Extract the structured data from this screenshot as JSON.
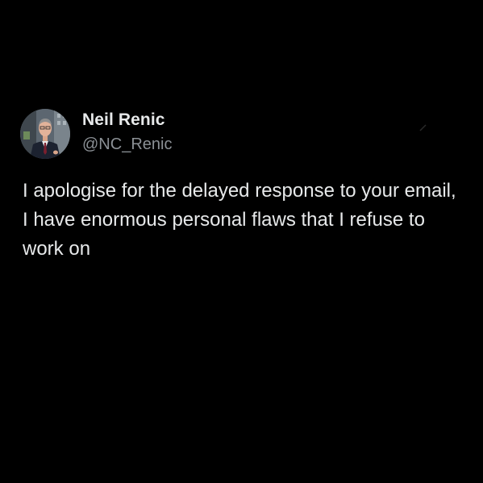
{
  "author": {
    "name": "Neil Renic",
    "handle": "@NC_Renic"
  },
  "tweet": {
    "text": "I apologise for the delayed response to your email, I have enormous personal flaws that I refuse to work on"
  },
  "colors": {
    "background": "#000000",
    "primary_text": "#e7e9ea",
    "secondary_text": "#8b9095"
  }
}
